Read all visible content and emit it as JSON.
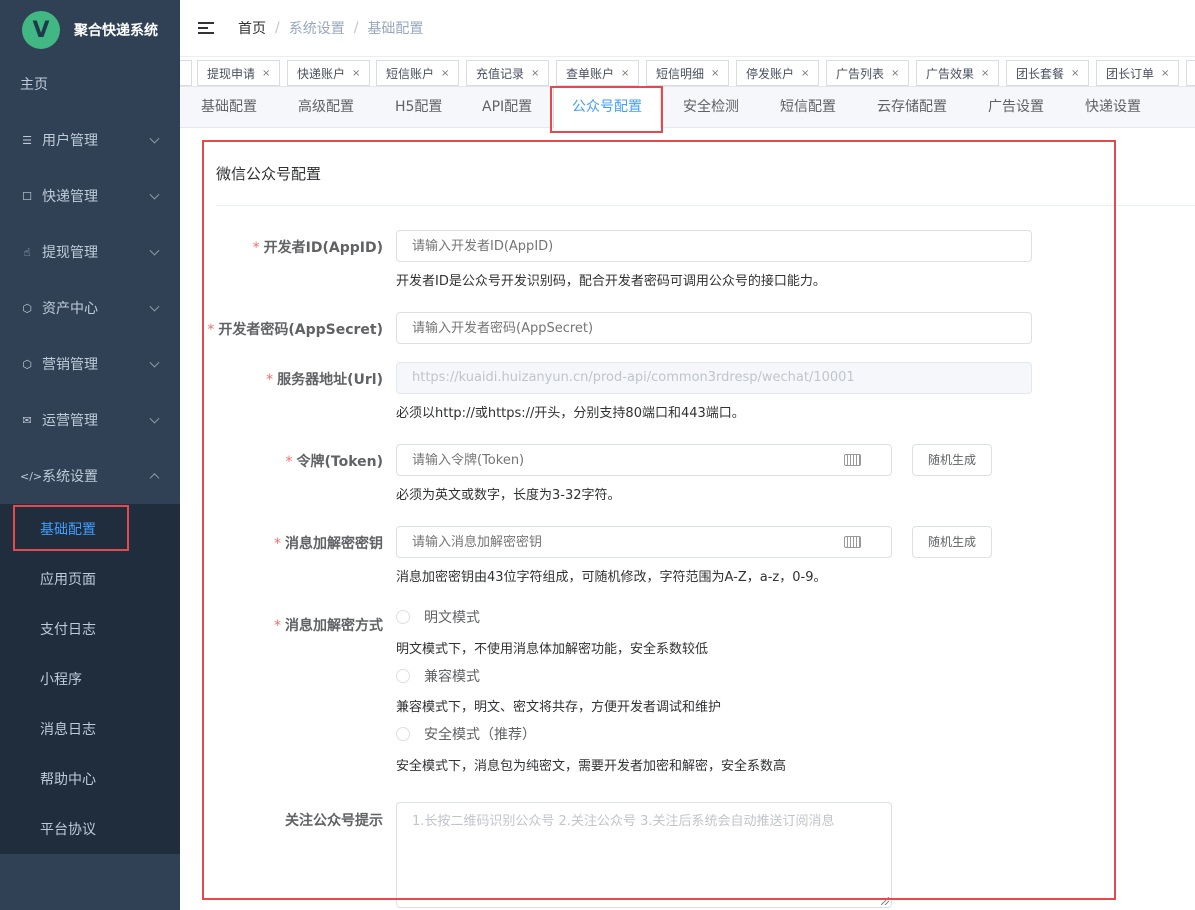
{
  "app": {
    "logo_letter": "V",
    "title": "聚合快递系统"
  },
  "sidebar": {
    "home": "主页",
    "items": [
      {
        "label": "用户管理",
        "icon": "list-icon"
      },
      {
        "label": "快递管理",
        "icon": "chat-icon"
      },
      {
        "label": "提现管理",
        "icon": "hand-icon"
      },
      {
        "label": "资产中心",
        "icon": "cube-icon"
      },
      {
        "label": "营销管理",
        "icon": "cube-icon"
      },
      {
        "label": "运营管理",
        "icon": "mail-icon"
      },
      {
        "label": "系统设置",
        "icon": "code-icon"
      }
    ],
    "submenu": [
      "基础配置",
      "应用页面",
      "支付日志",
      "小程序",
      "消息日志",
      "帮助中心",
      "平台协议"
    ]
  },
  "breadcrumb": [
    "首页",
    "系统设置",
    "基础配置"
  ],
  "tags": [
    "提现申请",
    "快递账户",
    "短信账户",
    "充值记录",
    "查单账户",
    "短信明细",
    "停发账户",
    "广告列表",
    "广告效果",
    "团长套餐",
    "团长订单"
  ],
  "tabs": [
    "基础配置",
    "高级配置",
    "H5配置",
    "API配置",
    "公众号配置",
    "安全检测",
    "短信配置",
    "云存储配置",
    "广告设置",
    "快递设置"
  ],
  "active_tab": "公众号配置",
  "form": {
    "card_title": "微信公众号配置",
    "appid": {
      "label": "开发者ID(AppID)",
      "placeholder": "请输入开发者ID(AppID)",
      "help": "开发者ID是公众号开发识别码，配合开发者密码可调用公众号的接口能力。"
    },
    "secret": {
      "label": "开发者密码(AppSecret)",
      "placeholder": "请输入开发者密码(AppSecret)"
    },
    "url": {
      "label": "服务器地址(Url)",
      "value": "https://kuaidi.huizanyun.cn/prod-api/common3rdresp/wechat/10001",
      "help": "必须以http://或https://开头，分别支持80端口和443端口。"
    },
    "token": {
      "label": "令牌(Token)",
      "placeholder": "请输入令牌(Token)",
      "button": "随机生成",
      "help": "必须为英文或数字，长度为3-32字符。"
    },
    "aeskey": {
      "label": "消息加解密密钥",
      "placeholder": "请输入消息加解密密钥",
      "button": "随机生成",
      "help": "消息加密密钥由43位字符组成，可随机修改，字符范围为A-Z，a-z，0-9。"
    },
    "mode": {
      "label": "消息加解密方式",
      "options": [
        {
          "label": "明文模式",
          "help": "明文模式下，不使用消息体加解密功能，安全系数较低"
        },
        {
          "label": "兼容模式",
          "help": "兼容模式下，明文、密文将共存，方便开发者调试和维护"
        },
        {
          "label": "安全模式（推荐）",
          "help": "安全模式下，消息包为纯密文，需要开发者加密和解密，安全系数高"
        }
      ]
    },
    "follow": {
      "label": "关注公众号提示",
      "placeholder": "1.长按二维码识别公众号 2.关注公众号 3.关注后系统会自动推送订阅消息"
    }
  },
  "colors": {
    "sidebar_bg": "#304156",
    "submenu_bg": "#1f2d3d",
    "accent": "#409eff",
    "required": "#f56c6c",
    "highlight": "#e5484d"
  }
}
